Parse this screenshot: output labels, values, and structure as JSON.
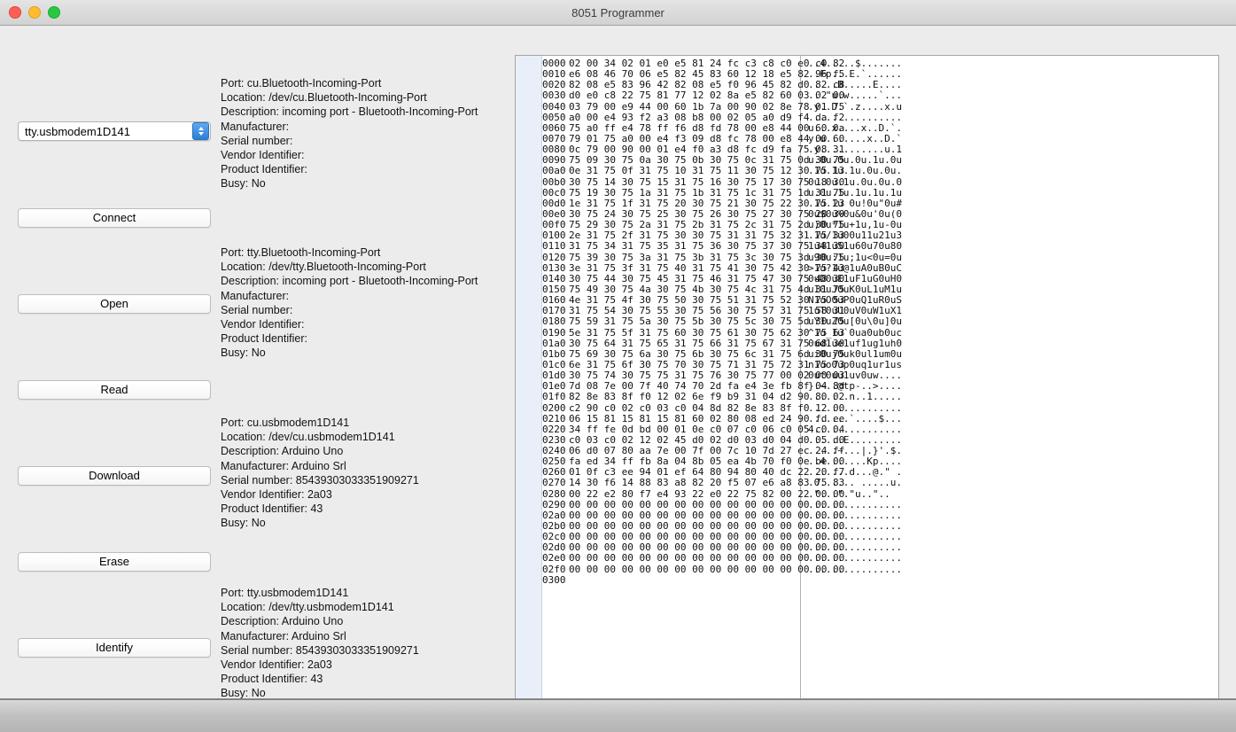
{
  "window": {
    "title": "8051 Programmer",
    "controls": {
      "close": "close-button",
      "minimize": "minimize-button",
      "maximize": "maximize-button"
    }
  },
  "sidebar": {
    "port_select": {
      "selected": "tty.usbmodem1D141"
    },
    "buttons": [
      {
        "label": "Connect"
      },
      {
        "label": "Open"
      },
      {
        "label": "Read"
      },
      {
        "label": "Download"
      },
      {
        "label": "Erase"
      },
      {
        "label": "Identify"
      }
    ]
  },
  "ports": [
    {
      "port": "Port: cu.Bluetooth-Incoming-Port",
      "location": "Location: /dev/cu.Bluetooth-Incoming-Port",
      "description": "Description: incoming port - Bluetooth-Incoming-Port",
      "manufacturer": "Manufacturer:",
      "serial": "Serial number:",
      "vendor": "Vendor Identifier:",
      "product": "Product Identifier:",
      "busy": "Busy: No"
    },
    {
      "port": "Port: tty.Bluetooth-Incoming-Port",
      "location": "Location: /dev/tty.Bluetooth-Incoming-Port",
      "description": "Description: incoming port - Bluetooth-Incoming-Port",
      "manufacturer": "Manufacturer:",
      "serial": "Serial number:",
      "vendor": "Vendor Identifier:",
      "product": "Product Identifier:",
      "busy": "Busy: No"
    },
    {
      "port": "Port: cu.usbmodem1D141",
      "location": "Location: /dev/cu.usbmodem1D141",
      "description": "Description: Arduino Uno",
      "manufacturer": "Manufacturer: Arduino Srl",
      "serial": "Serial number: 85439303033351909271",
      "vendor": "Vendor Identifier: 2a03",
      "product": "Product Identifier: 43",
      "busy": "Busy: No"
    },
    {
      "port": "Port: tty.usbmodem1D141",
      "location": "Location: /dev/tty.usbmodem1D141",
      "description": "Description: Arduino Uno",
      "manufacturer": "Manufacturer: Arduino Srl",
      "serial": "Serial number: 85439303033351909271",
      "vendor": "Vendor Identifier: 2a03",
      "product": "Product Identifier: 43",
      "busy": "Busy: No"
    }
  ],
  "hexdump": {
    "end_offset": "0300",
    "rows": [
      {
        "offset": "0000",
        "bytes": "02 00 34 02 01 e0 e5 81 24 fc c3 c8 c0 e0 c0 82",
        "ascii": "..4.....$......."
      },
      {
        "offset": "0010",
        "bytes": "e6 08 46 70 06 e5 82 45 83 60 12 18 e5 82 96 f5",
        "ascii": "..Fp...E.`......"
      },
      {
        "offset": "0020",
        "bytes": "82 08 e5 83 96 42 82 08 e5 f0 96 45 82 d0 82 c8",
        "ascii": ".....B.....E...."
      },
      {
        "offset": "0030",
        "bytes": "d0 e0 c8 22 75 81 77 12 02 8a e5 82 60 03 02 00",
        "ascii": "...\"u.w.....`..."
      },
      {
        "offset": "0040",
        "bytes": "03 79 00 e9 44 00 60 1b 7a 00 90 02 8e 78 01 75",
        "ascii": ".y..D.`.z....x.u"
      },
      {
        "offset": "0050",
        "bytes": "a0 00 e4 93 f2 a3 08 b8 00 02 05 a0 d9 f4 da f2",
        "ascii": "................"
      },
      {
        "offset": "0060",
        "bytes": "75 a0 ff e4 78 ff f6 d8 fd 78 00 e8 44 00 60 0a",
        "ascii": "u...x....x..D.`."
      },
      {
        "offset": "0070",
        "bytes": "79 01 75 a0 00 e4 f3 09 d8 fc 78 00 e8 44 00 60",
        "ascii": "y.u.......x..D.`"
      },
      {
        "offset": "0080",
        "bytes": "0c 79 00 90 00 01 e4 f0 a3 d8 fc d9 fa 75 08 31",
        "ascii": ".y...........u.1"
      },
      {
        "offset": "0090",
        "bytes": "75 09 30 75 0a 30 75 0b 30 75 0c 31 75 0d 30 75",
        "ascii": "u.0u.0u.0u.1u.0u"
      },
      {
        "offset": "00a0",
        "bytes": "0e 31 75 0f 31 75 10 31 75 11 30 75 12 30 75 13",
        "ascii": ".1u.1u.1u.0u.0u."
      },
      {
        "offset": "00b0",
        "bytes": "30 75 14 30 75 15 31 75 16 30 75 17 30 75 18 30",
        "ascii": "0u.0u.1u.0u.0u.0"
      },
      {
        "offset": "00c0",
        "bytes": "75 19 30 75 1a 31 75 1b 31 75 1c 31 75 1d 31 75",
        "ascii": "u.0u.1u.1u.1u.1u"
      },
      {
        "offset": "00d0",
        "bytes": "1e 31 75 1f 31 75 20 30 75 21 30 75 22 30 75 23",
        "ascii": ".1u.1u 0u!0u\"0u#"
      },
      {
        "offset": "00e0",
        "bytes": "30 75 24 30 75 25 30 75 26 30 75 27 30 75 28 30",
        "ascii": "0u$0u%0u&0u'0u(0"
      },
      {
        "offset": "00f0",
        "bytes": "75 29 30 75 2a 31 75 2b 31 75 2c 31 75 2d 30 75",
        "ascii": "u)0u*1u+1u,1u-0u"
      },
      {
        "offset": "0100",
        "bytes": "2e 31 75 2f 31 75 30 30 75 31 31 75 32 31 75 33",
        "ascii": ".1u/1u00u11u21u3"
      },
      {
        "offset": "0110",
        "bytes": "31 75 34 31 75 35 31 75 36 30 75 37 30 75 38 30",
        "ascii": "1u41u51u60u70u80"
      },
      {
        "offset": "0120",
        "bytes": "75 39 30 75 3a 31 75 3b 31 75 3c 30 75 3d 30 75",
        "ascii": "u90u:1u;1u<0u=0u"
      },
      {
        "offset": "0130",
        "bytes": "3e 31 75 3f 31 75 40 31 75 41 30 75 42 30 75 43",
        "ascii": ">1u?1u@1uA0uB0uC"
      },
      {
        "offset": "0140",
        "bytes": "30 75 44 30 75 45 31 75 46 31 75 47 30 75 48 30",
        "ascii": "0uD0uE1uF1uG0uH0"
      },
      {
        "offset": "0150",
        "bytes": "75 49 30 75 4a 30 75 4b 30 75 4c 31 75 4d 31 75",
        "ascii": "uI0uJ0uK0uL1uM1u"
      },
      {
        "offset": "0160",
        "bytes": "4e 31 75 4f 30 75 50 30 75 51 31 75 52 30 75 53",
        "ascii": "N1uO0uP0uQ1uR0uS"
      },
      {
        "offset": "0170",
        "bytes": "31 75 54 30 75 55 30 75 56 30 75 57 31 75 58 31",
        "ascii": "1uT0uU0uV0uW1uX1"
      },
      {
        "offset": "0180",
        "bytes": "75 59 31 75 5a 30 75 5b 30 75 5c 30 75 5d 30 75",
        "ascii": "uY1uZ0u[0u\\0u]0u"
      },
      {
        "offset": "0190",
        "bytes": "5e 31 75 5f 31 75 60 30 75 61 30 75 62 30 75 63",
        "ascii": "^1u_1u`0ua0ub0uc"
      },
      {
        "offset": "01a0",
        "bytes": "30 75 64 31 75 65 31 75 66 31 75 67 31 75 68 30",
        "ascii": "0ud1ue1uf1ug1uh0"
      },
      {
        "offset": "01b0",
        "bytes": "75 69 30 75 6a 30 75 6b 30 75 6c 31 75 6d 30 75",
        "ascii": "ui0uj0uk0ul1um0u"
      },
      {
        "offset": "01c0",
        "bytes": "6e 31 75 6f 30 75 70 30 75 71 31 75 72 31 75 73",
        "ascii": "n1uo0up0uq1ur1us"
      },
      {
        "offset": "01d0",
        "bytes": "30 75 74 30 75 75 31 75 76 30 75 77 00 02 00 03",
        "ascii": "0ut0uu1uv0uw...."
      },
      {
        "offset": "01e0",
        "bytes": "7d 08 7e 00 7f 40 74 70 2d fa e4 3e fb 8f 04 8d",
        "ascii": "}.~..@tp-..>...."
      },
      {
        "offset": "01f0",
        "bytes": "82 8e 83 8f f0 12 02 6e f9 b9 31 04 d2 90 80 02",
        "ascii": ".......n..1....."
      },
      {
        "offset": "0200",
        "bytes": "c2 90 c0 02 c0 03 c0 04 8d 82 8e 83 8f f0 12 00",
        "ascii": "................"
      },
      {
        "offset": "0210",
        "bytes": "06 15 81 15 81 15 81 60 02 80 08 ed 24 90 fd ee",
        "ascii": ".......`....$..."
      },
      {
        "offset": "0220",
        "bytes": "34 ff fe 0d bd 00 01 0e c0 07 c0 06 c0 05 c0 04",
        "ascii": "4..............."
      },
      {
        "offset": "0230",
        "bytes": "c0 03 c0 02 12 02 45 d0 02 d0 03 d0 04 d0 05 d0",
        "ascii": "......E........."
      },
      {
        "offset": "0240",
        "bytes": "06 d0 07 80 aa 7e 00 7f 00 7c 10 7d 27 ec 24 ff",
        "ascii": ".....~...|.}'.$."
      },
      {
        "offset": "0250",
        "bytes": "fa ed 34 ff fb 8a 04 8b 05 ea 4b 70 f0 0e be 00",
        "ascii": "..4.......Kp...."
      },
      {
        "offset": "0260",
        "bytes": "01 0f c3 ee 94 01 ef 64 80 94 80 40 dc 22 20 f7",
        "ascii": ".......d...@.\" ."
      },
      {
        "offset": "0270",
        "bytes": "14 30 f6 14 88 83 a8 82 20 f5 07 e6 a8 83 75 83",
        "ascii": ".0...... .....u."
      },
      {
        "offset": "0280",
        "bytes": "00 22 e2 80 f7 e4 93 22 e0 22 75 82 00 22 00 00",
        "ascii": ".\"...\".\"u..\".."
      },
      {
        "offset": "0290",
        "bytes": "00 00 00 00 00 00 00 00 00 00 00 00 00 00 00 00",
        "ascii": "................"
      },
      {
        "offset": "02a0",
        "bytes": "00 00 00 00 00 00 00 00 00 00 00 00 00 00 00 00",
        "ascii": "................"
      },
      {
        "offset": "02b0",
        "bytes": "00 00 00 00 00 00 00 00 00 00 00 00 00 00 00 00",
        "ascii": "................"
      },
      {
        "offset": "02c0",
        "bytes": "00 00 00 00 00 00 00 00 00 00 00 00 00 00 00 00",
        "ascii": "................"
      },
      {
        "offset": "02d0",
        "bytes": "00 00 00 00 00 00 00 00 00 00 00 00 00 00 00 00",
        "ascii": "................"
      },
      {
        "offset": "02e0",
        "bytes": "00 00 00 00 00 00 00 00 00 00 00 00 00 00 00 00",
        "ascii": "................"
      },
      {
        "offset": "02f0",
        "bytes": "00 00 00 00 00 00 00 00 00 00 00 00 00 00 00 00",
        "ascii": "................"
      }
    ]
  }
}
